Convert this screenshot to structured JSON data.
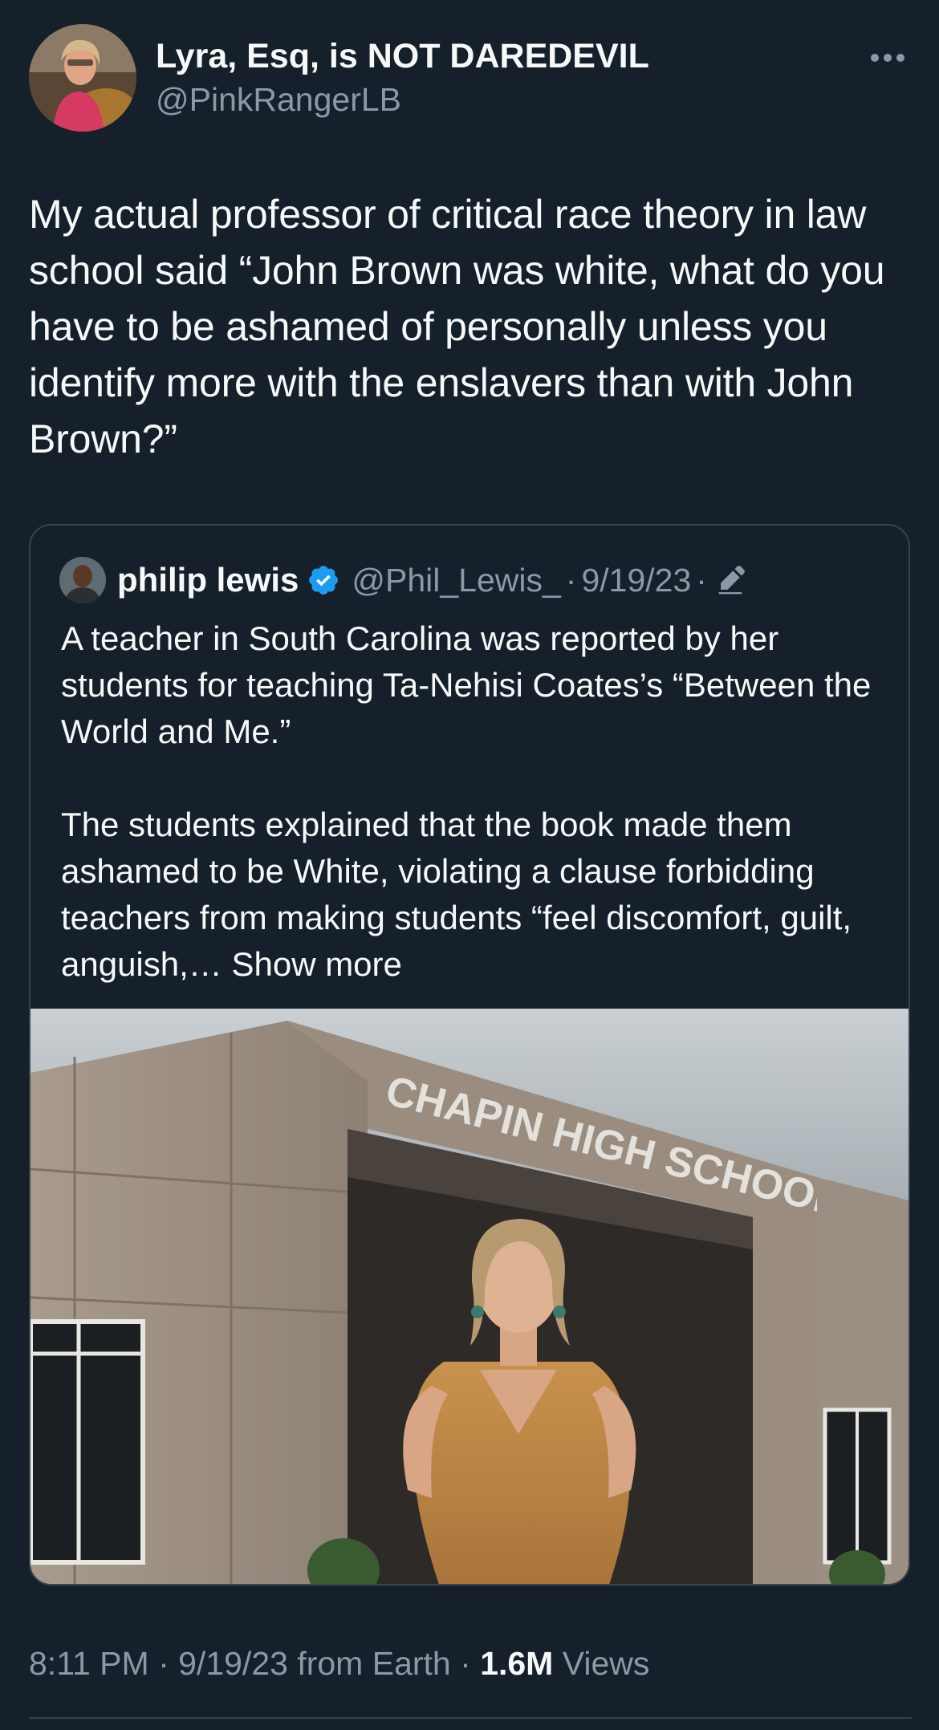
{
  "author": {
    "display_name": "Lyra, Esq, is NOT DAREDEVIL",
    "handle": "@PinkRangerLB",
    "avatar_icon": "profile-photo"
  },
  "tweet": {
    "text": "My actual professor of critical race theory in law school said “John Brown was white, what do you have to be ashamed of personally unless you identify more with the enslavers than with John Brown?”"
  },
  "quoted": {
    "name": "philip lewis",
    "verified_icon": "verified-badge-icon",
    "handle": "@Phil_Lewis_",
    "dot": "·",
    "date": "9/19/23",
    "edited_icon": "edit-pencil-icon",
    "paragraph1": "A teacher in South Carolina was reported by her students for teaching Ta-Nehisi Coates’s “Between the World and Me.”",
    "paragraph2": "The students explained that the book made them ashamed to be White, violating a clause forbidding teachers from making students “feel discomfort, guilt, anguish,…",
    "show_more": "Show more",
    "image": {
      "sign_text": "CHAPIN HIGH SCHOOL"
    }
  },
  "footer": {
    "time": "8:11 PM",
    "sep": "·",
    "date": "9/19/23",
    "source": "from Earth",
    "views_count": "1.6M",
    "views_label": "Views"
  },
  "colors": {
    "background": "#15202b",
    "text_primary": "#f7f9f9",
    "text_secondary": "#8b98a5",
    "border": "#38444d",
    "verified": "#1d9bf0"
  }
}
